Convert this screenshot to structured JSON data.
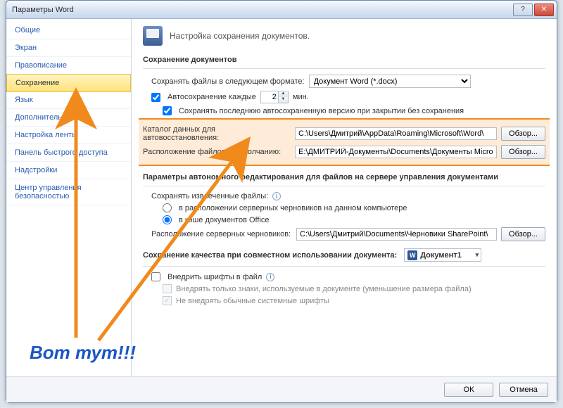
{
  "window": {
    "title": "Параметры Word"
  },
  "titlebar_buttons": {
    "help": "?",
    "close": "✕"
  },
  "sidebar": {
    "items": [
      {
        "label": "Общие"
      },
      {
        "label": "Экран"
      },
      {
        "label": "Правописание"
      },
      {
        "label": "Сохранение",
        "selected": true
      },
      {
        "label": "Язык"
      },
      {
        "label": "Дополнительно"
      },
      {
        "label": "Настройка ленты"
      },
      {
        "label": "Панель быстрого доступа"
      },
      {
        "label": "Надстройки"
      },
      {
        "label": "Центр управления безопасностью"
      }
    ]
  },
  "header": {
    "text": "Настройка сохранения документов."
  },
  "section1": {
    "title": "Сохранение документов",
    "save_format_label": "Сохранять файлы в следующем формате:",
    "save_format_value": "Документ Word (*.docx)",
    "autosave_label": "Автосохранение каждые",
    "autosave_value": "2",
    "autosave_unit": "мин.",
    "keep_last_label": "Сохранять последнюю автосохраненную версию при закрытии без сохранения",
    "autorecover_label": "Каталог данных для автовосстановления:",
    "autorecover_path": "C:\\Users\\Дмитрий\\AppData\\Roaming\\Microsoft\\Word\\",
    "default_loc_label": "Расположение файлов по умолчанию:",
    "default_loc_path": "E:\\ДМИТРИЙ-Документы\\Documents\\Документы Microsoft Word",
    "browse": "Обзор..."
  },
  "section2": {
    "title": "Параметры автономного редактирования для файлов на сервере управления документами",
    "save_checkedout_label": "Сохранять извлеченные файлы:",
    "radio1": "в расположении серверных черновиков на данном компьютере",
    "radio2": "в кэше документов Office",
    "drafts_label": "Расположение серверных черновиков:",
    "drafts_path": "C:\\Users\\Дмитрий\\Documents\\Черновики SharePoint\\",
    "browse": "Обзор..."
  },
  "section3": {
    "title": "Сохранение качества при совместном использовании документа:",
    "doc_name": "Документ1",
    "embed_fonts": "Внедрить шрифты в файл",
    "embed_only_used": "Внедрять только знаки, используемые в документе (уменьшение размера файла)",
    "no_system_fonts": "Не внедрять обычные системные шрифты"
  },
  "footer": {
    "ok": "ОК",
    "cancel": "Отмена"
  },
  "annotation": {
    "text": "Вот тут!!!"
  },
  "colors": {
    "arrow": "#f08a1d"
  }
}
